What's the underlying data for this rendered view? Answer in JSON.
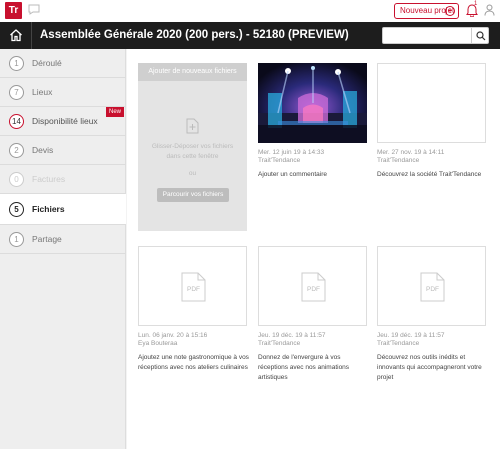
{
  "topbar": {
    "logo_text": "Tr",
    "new_project_label": "Nouveau projet",
    "notification_count": "1"
  },
  "header": {
    "title": "Assemblée Générale 2020 (200 pers.) - 52180 (PREVIEW)",
    "search_placeholder": ""
  },
  "sidebar": {
    "items": [
      {
        "num": "1",
        "label": "Déroulé",
        "state": "normal"
      },
      {
        "num": "7",
        "label": "Lieux",
        "state": "normal"
      },
      {
        "num": "14",
        "label": "Disponibilité lieux",
        "state": "red",
        "badge": "New"
      },
      {
        "num": "2",
        "label": "Devis",
        "state": "normal"
      },
      {
        "num": "0",
        "label": "Factures",
        "state": "faint"
      },
      {
        "num": "5",
        "label": "Fichiers",
        "state": "active"
      },
      {
        "num": "1",
        "label": "Partage",
        "state": "normal"
      }
    ]
  },
  "upload": {
    "header": "Ajouter de nouveaux fichiers",
    "drop_text": "Glisser-Déposer vos fichiers dans cette fenêtre",
    "or": "ou",
    "browse": "Parcourir vos fichiers"
  },
  "files": [
    {
      "date": "Mer. 12 juin 19 à 14:33",
      "author": "Trait'Tendance",
      "desc": "Ajouter un commentaire",
      "kind": "photo"
    },
    {
      "date": "Mer. 27 nov. 19 à 14:11",
      "author": "Trait'Tendance",
      "desc": "Découvrez la société Trait'Tendance",
      "kind": "blank"
    },
    {
      "date": "Lun. 06 janv. 20 à 15:16",
      "author": "Eya Bouteraa",
      "desc": "Ajoutez une note gastronomique à vos réceptions avec nos ateliers culinaires",
      "kind": "pdf",
      "icon_label": "PDF"
    },
    {
      "date": "Jeu. 19 déc. 19 à 11:57",
      "author": "Trait'Tendance",
      "desc": "Donnez de l'envergure à vos réceptions avec nos animations artistiques",
      "kind": "pdf",
      "icon_label": "PDF"
    },
    {
      "date": "Jeu. 19 déc. 19 à 11:57",
      "author": "Trait'Tendance",
      "desc": "Découvrez nos outils inédits et innovants qui accompagneront votre projet",
      "kind": "pdf",
      "icon_label": "PDF"
    }
  ],
  "colors": {
    "accent": "#c8102e",
    "dark": "#1d1d1d"
  }
}
